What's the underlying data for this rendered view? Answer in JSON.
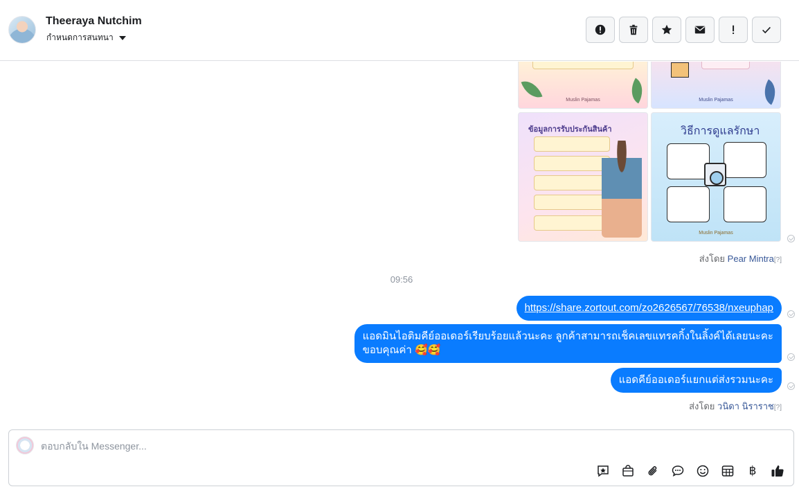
{
  "header": {
    "contact_name": "Theeraya Nutchim",
    "assign_label": "กำหนดการสนทนา",
    "actions": [
      {
        "icon": "alert-circle-icon"
      },
      {
        "icon": "trash-icon"
      },
      {
        "icon": "star-icon"
      },
      {
        "icon": "envelope-icon"
      },
      {
        "icon": "exclamation-icon"
      },
      {
        "icon": "check-icon"
      }
    ]
  },
  "images": {
    "tile3_title": "ข้อมูลการรับประกันสินค้า",
    "tile4_title": "วิธีการดูแลรักษา",
    "brand": "Muslin Pajamas"
  },
  "sent_by_1": {
    "prefix": "ส่งโดย",
    "name": "Pear Mintra",
    "help": "[?]"
  },
  "time_separator": "09:56",
  "messages": [
    {
      "text": "https://share.zortout.com/zo2626567/76538/nxeuphap"
    },
    {
      "line1": "แอดมินไอติมคีย์ออเดอร์เรียบร้อยแล้วนะคะ ลูกค้าสามารถเช็คเลขแทรคกิ้งในลิ้งค์ได้เลยนะคะ",
      "line2": "ขอบคุณค่า 🥰🥰"
    },
    {
      "text": "แอดคีย์ออเดอร์แยกแต่ส่งรวมนะคะ"
    }
  ],
  "sent_by_2": {
    "prefix": "ส่งโดย",
    "name": "วนิดา นิราราช",
    "help": "[?]"
  },
  "composer": {
    "placeholder": "ตอบกลับใน Messenger...",
    "tools": [
      "saved-reply-icon",
      "shopping-bag-icon",
      "paperclip-icon",
      "chat-bubble-icon",
      "emoji-icon",
      "table-icon",
      "baht-icon",
      "thumbs-up-icon"
    ],
    "baht_symbol": "฿"
  },
  "colors": {
    "bubble": "#0a7cff",
    "link": "#385898",
    "muted": "#65676b"
  }
}
